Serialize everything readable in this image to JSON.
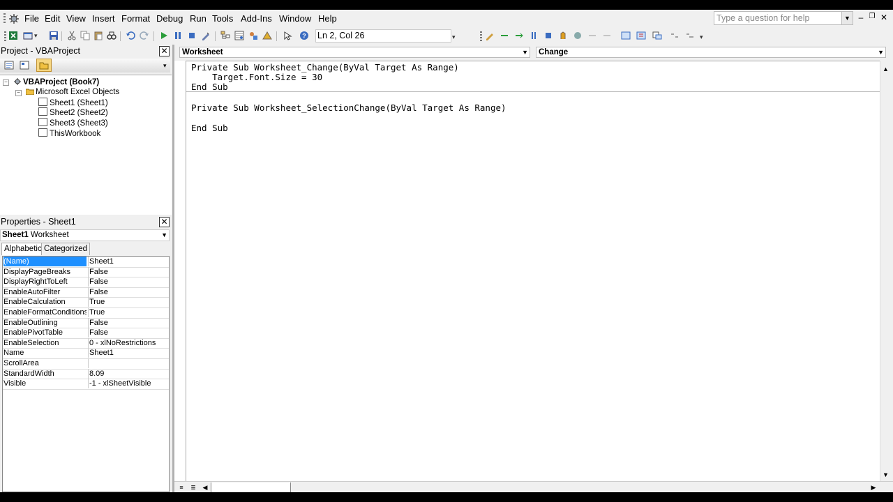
{
  "menubar": {
    "items": [
      "File",
      "Edit",
      "View",
      "Insert",
      "Format",
      "Debug",
      "Run",
      "Tools",
      "Add-Ins",
      "Window",
      "Help"
    ],
    "help_placeholder": "Type a question for help"
  },
  "toolbar": {
    "cursor_position": "Ln 2, Col 26"
  },
  "project": {
    "title": "Project - VBAProject",
    "root": "VBAProject (Book7)",
    "folder": "Microsoft Excel Objects",
    "items": [
      "Sheet1 (Sheet1)",
      "Sheet2 (Sheet2)",
      "Sheet3 (Sheet3)",
      "ThisWorkbook"
    ]
  },
  "properties": {
    "title": "Properties - Sheet1",
    "object_name": "Sheet1",
    "object_type": "Worksheet",
    "tabs": [
      "Alphabetic",
      "Categorized"
    ],
    "rows": [
      {
        "key": "(Name)",
        "value": "Sheet1"
      },
      {
        "key": "DisplayPageBreaks",
        "value": "False"
      },
      {
        "key": "DisplayRightToLeft",
        "value": "False"
      },
      {
        "key": "EnableAutoFilter",
        "value": "False"
      },
      {
        "key": "EnableCalculation",
        "value": "True"
      },
      {
        "key": "EnableFormatConditionsCalculation",
        "value": "True"
      },
      {
        "key": "EnableOutlining",
        "value": "False"
      },
      {
        "key": "EnablePivotTable",
        "value": "False"
      },
      {
        "key": "EnableSelection",
        "value": "0 - xlNoRestrictions"
      },
      {
        "key": "Name",
        "value": "Sheet1"
      },
      {
        "key": "ScrollArea",
        "value": ""
      },
      {
        "key": "StandardWidth",
        "value": "8.09"
      },
      {
        "key": "Visible",
        "value": "-1 - xlSheetVisible"
      }
    ]
  },
  "code": {
    "object_combo": "Worksheet",
    "procedure_combo": "Change",
    "lines": [
      "Private Sub Worksheet_Change(ByVal Target As Range)",
      "    Target.Font.Size = 30",
      "End Sub",
      "Private Sub Worksheet_SelectionChange(ByVal Target As Range)",
      "",
      "End Sub"
    ]
  },
  "colors": {
    "selection": "#1e90ff",
    "background": "#f0f0f0"
  }
}
